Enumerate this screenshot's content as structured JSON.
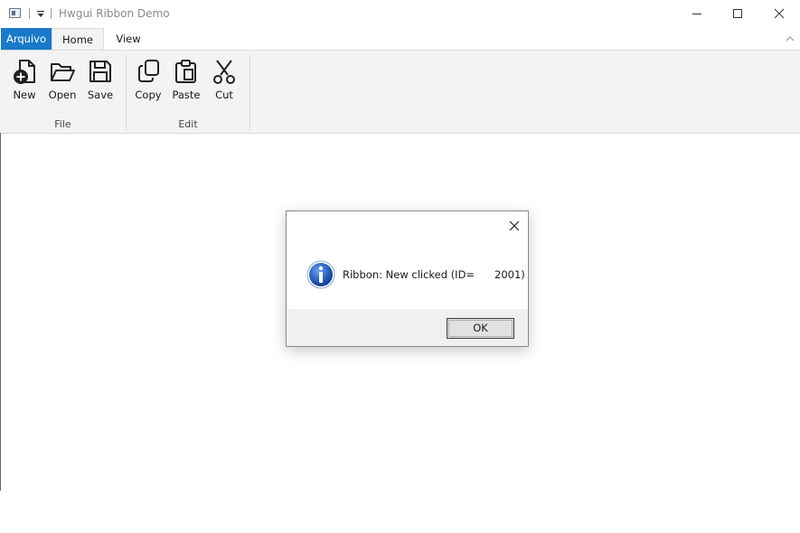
{
  "window": {
    "title": "Hwgui Ribbon Demo"
  },
  "tabs": [
    {
      "label": "Arquivo"
    },
    {
      "label": "Home"
    },
    {
      "label": "View"
    }
  ],
  "ribbon": {
    "groups": [
      {
        "label": "File",
        "buttons": [
          {
            "label": "New",
            "icon": "new-document-icon"
          },
          {
            "label": "Open",
            "icon": "folder-open-icon"
          },
          {
            "label": "Save",
            "icon": "floppy-disk-icon"
          }
        ]
      },
      {
        "label": "Edit",
        "buttons": [
          {
            "label": "Copy",
            "icon": "copy-icon"
          },
          {
            "label": "Paste",
            "icon": "clipboard-paste-icon"
          },
          {
            "label": "Cut",
            "icon": "scissors-icon"
          }
        ]
      }
    ]
  },
  "dialog": {
    "message": "Ribbon: New clicked (ID=      2001)",
    "ok_label": "OK",
    "icon": "information-icon"
  },
  "colors": {
    "accent": "#1979ca",
    "ribbon_bg": "#f3f3f3",
    "dialog_footer_bg": "#f0f0f0"
  }
}
